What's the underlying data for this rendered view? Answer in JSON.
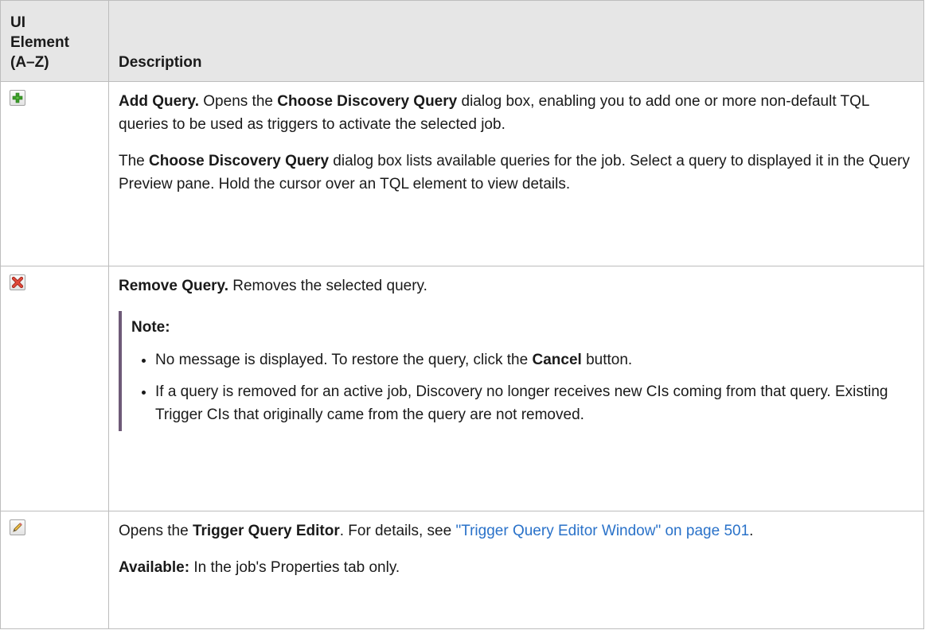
{
  "header": {
    "col1_lines": [
      "UI",
      "Element",
      "(A–Z)"
    ],
    "col2": "Description"
  },
  "rows": [
    {
      "icon": "add-icon",
      "para1": {
        "title": "Add Query.",
        "t1": " Opens the ",
        "b1": "Choose Discovery Query",
        "t2": " dialog box, enabling you to add one or more non-default TQL queries to be used as triggers to activate the selected job."
      },
      "para2": {
        "t0": "The ",
        "b1": "Choose Discovery Query",
        "t1": " dialog box lists available queries for the job. Select a query to displayed it in the Query Preview pane. Hold the cursor over an TQL element to view details."
      }
    },
    {
      "icon": "remove-icon",
      "para1": {
        "title": "Remove Query.",
        "t1": " Removes the selected query."
      },
      "note": {
        "title": "Note:",
        "item1_t1": "No message is displayed. To restore the query, click the ",
        "item1_b1": "Cancel",
        "item1_t2": " button.",
        "item2": "If a query is removed for an active job, Discovery no longer receives new CIs coming from that query. Existing Trigger CIs that originally came from the query are not removed."
      }
    },
    {
      "icon": "edit-icon",
      "para1": {
        "t0": "Opens the ",
        "b1": "Trigger Query Editor",
        "t1": ". For details, see ",
        "link": "\"Trigger Query Editor Window\" on page 501",
        "t2": "."
      },
      "para2": {
        "b0": "Available:",
        "t1": " In the job's Properties tab only."
      }
    }
  ],
  "colors": {
    "header_bg": "#e6e6e6",
    "border": "#bdbdbd",
    "link": "#2a72c9",
    "note_bar": "#6e5a78"
  }
}
